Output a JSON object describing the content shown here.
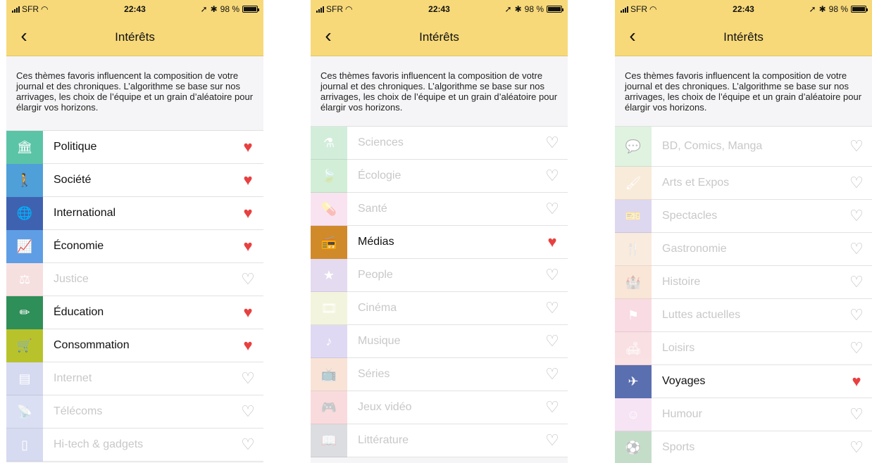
{
  "status": {
    "carrier": "SFR",
    "time": "22:43",
    "battery": "98 %"
  },
  "nav": {
    "title": "Intérêts",
    "back": "‹"
  },
  "intro": "Ces thèmes favoris influencent la composition de votre journal et des chroniques. L’algorithme se base sur nos arrivages, les choix de l’équipe et un grain d’aléatoire pour élargir vos horizons.",
  "colors": {
    "header": "#f7d97a",
    "heart_on": "#e84040",
    "heart_off": "#bdbdbd"
  },
  "screens": [
    {
      "items": [
        {
          "label": "Politique",
          "icon": "bank-icon",
          "glyph": "🏛",
          "color": "#5bc4a6",
          "on": true
        },
        {
          "label": "Société",
          "icon": "person-icon",
          "glyph": "🚶",
          "color": "#4f9fd9",
          "on": true
        },
        {
          "label": "International",
          "icon": "globe-icon",
          "glyph": "🌐",
          "color": "#3f62b0",
          "on": true
        },
        {
          "label": "Économie",
          "icon": "trend-icon",
          "glyph": "📈",
          "color": "#5f9ee5",
          "on": true
        },
        {
          "label": "Justice",
          "icon": "gavel-icon",
          "glyph": "⚖",
          "color": "#e7a6a6",
          "on": false
        },
        {
          "label": "Éducation",
          "icon": "pencil-icon",
          "glyph": "✏",
          "color": "#2f8f58",
          "on": true
        },
        {
          "label": "Consommation",
          "icon": "cart-icon",
          "glyph": "🛒",
          "color": "#b8c32c",
          "on": true
        },
        {
          "label": "Internet",
          "icon": "browser-icon",
          "glyph": "▤",
          "color": "#8d97d6",
          "on": false
        },
        {
          "label": "Télécoms",
          "icon": "antenna-icon",
          "glyph": "📡",
          "color": "#9aa6dd",
          "on": false
        },
        {
          "label": "Hi-tech & gadgets",
          "icon": "phone-icon",
          "glyph": "▯",
          "color": "#8d9ad8",
          "on": false
        }
      ]
    },
    {
      "items": [
        {
          "label": "Sciences",
          "icon": "flask-icon",
          "glyph": "⚗",
          "color": "#7fcf9b",
          "on": false
        },
        {
          "label": "Écologie",
          "icon": "leaf-icon",
          "glyph": "🍃",
          "color": "#7fcf8f",
          "on": false
        },
        {
          "label": "Santé",
          "icon": "pill-icon",
          "glyph": "💊",
          "color": "#f0b0d8",
          "on": false
        },
        {
          "label": "Médias",
          "icon": "radio-icon",
          "glyph": "📻",
          "color": "#d08a2a",
          "on": true
        },
        {
          "label": "People",
          "icon": "star-icon",
          "glyph": "★",
          "color": "#b59ad6",
          "on": false
        },
        {
          "label": "Cinéma",
          "icon": "film-icon",
          "glyph": "🎞",
          "color": "#dfe0a0",
          "on": false
        },
        {
          "label": "Musique",
          "icon": "music-icon",
          "glyph": "♪",
          "color": "#a895dd",
          "on": false
        },
        {
          "label": "Séries",
          "icon": "tv-icon",
          "glyph": "📺",
          "color": "#f0b090",
          "on": false
        },
        {
          "label": "Jeux vidéo",
          "icon": "gamepad-icon",
          "glyph": "🎮",
          "color": "#f09aa0",
          "on": false
        },
        {
          "label": "Littérature",
          "icon": "book-icon",
          "glyph": "📖",
          "color": "#9aa0a8",
          "on": false
        }
      ]
    },
    {
      "items": [
        {
          "label": "BD, Comics, Manga",
          "icon": "speech-bubble-icon",
          "glyph": "💬",
          "color": "#a8dba8",
          "on": false
        },
        {
          "label": "Arts et Expos",
          "icon": "brush-icon",
          "glyph": "🖌",
          "color": "#f0c898",
          "on": false
        },
        {
          "label": "Spectacles",
          "icon": "ticket-icon",
          "glyph": "🎫",
          "color": "#9f8fd6",
          "on": false
        },
        {
          "label": "Gastronomie",
          "icon": "cutlery-icon",
          "glyph": "🍴",
          "color": "#f0c8a0",
          "on": false
        },
        {
          "label": "Histoire",
          "icon": "monument-icon",
          "glyph": "🏰",
          "color": "#f0b890",
          "on": false
        },
        {
          "label": "Luttes actuelles",
          "icon": "flag-icon",
          "glyph": "⚑",
          "color": "#f09ab0",
          "on": false
        },
        {
          "label": "Loisirs",
          "icon": "sofa-icon",
          "glyph": "🛋",
          "color": "#f0a8b0",
          "on": false
        },
        {
          "label": "Voyages",
          "icon": "plane-icon",
          "glyph": "✈",
          "color": "#5a6fb0",
          "on": true
        },
        {
          "label": "Humour",
          "icon": "smile-icon",
          "glyph": "☺",
          "color": "#e8b0e0",
          "on": false
        },
        {
          "label": "Sports",
          "icon": "ball-icon",
          "glyph": "⚽",
          "color": "#5aa068",
          "on": false
        }
      ]
    }
  ]
}
